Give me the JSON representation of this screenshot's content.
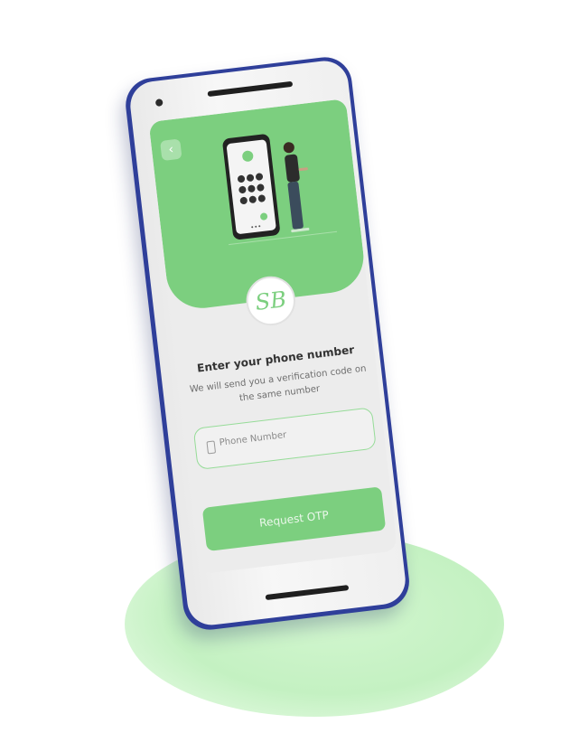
{
  "screen": {
    "title": "Enter your phone number",
    "subtitle": "We will send you a verification code on the same number",
    "phone_placeholder": "Phone Number",
    "request_button": "Request OTP",
    "logo_text": "SB"
  },
  "icons": {
    "back": "chevron-left-icon",
    "phone_input": "smartphone-icon"
  },
  "colors": {
    "accent": "#7ccf7f",
    "phone_frame": "#2f3f9a",
    "background_glow": "#c4f1c2"
  }
}
